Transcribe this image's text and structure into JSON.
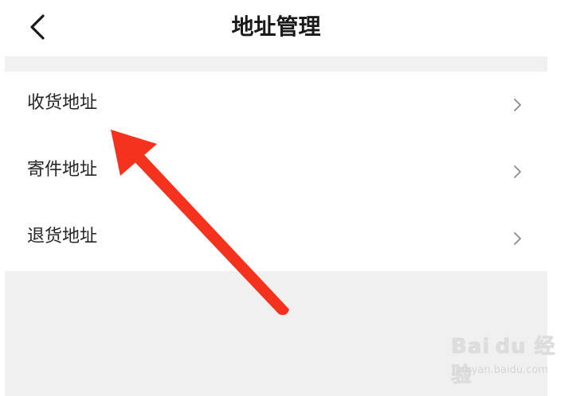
{
  "header": {
    "title": "地址管理",
    "back_icon": "chevron-left-icon"
  },
  "menu": {
    "items": [
      {
        "label": "收货地址",
        "icon": "chevron-right-icon"
      },
      {
        "label": "寄件地址",
        "icon": "chevron-right-icon"
      },
      {
        "label": "退货地址",
        "icon": "chevron-right-icon"
      }
    ]
  },
  "annotation": {
    "color": "#f4321e",
    "points_to": "收货地址"
  },
  "watermark": {
    "brand": "Bai du 经验",
    "url": "jingyan.baidu.com"
  },
  "colors": {
    "background": "#f0f0f0",
    "surface": "#ffffff",
    "text": "#262626",
    "chevron": "#8c8c8c"
  }
}
